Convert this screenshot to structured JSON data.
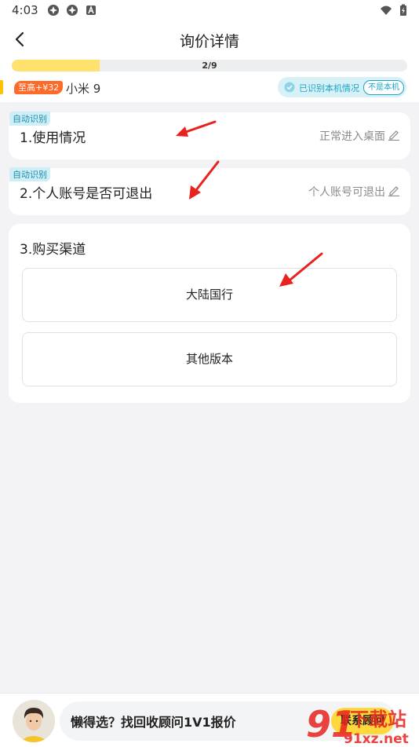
{
  "status_bar": {
    "time": "4:03"
  },
  "header": {
    "title": "询价详情"
  },
  "progress": {
    "text": "2/9",
    "fraction": 0.2222
  },
  "info": {
    "price_badge": "至高+¥32",
    "model": "小米 9",
    "detect_text": "已识别本机情况",
    "not_this_label": "不是本机"
  },
  "questions": [
    {
      "tag": "自动识别",
      "title": "1.使用情况",
      "value": "正常进入桌面"
    },
    {
      "tag": "自动识别",
      "title": "2.个人账号是否可退出",
      "value": "个人账号可退出"
    },
    {
      "title": "3.购买渠道",
      "options": [
        "大陆国行",
        "其他版本"
      ]
    }
  ],
  "bottom": {
    "consult_text": "懒得选？找回收顾问1V1报价",
    "contact_label": "联系顾问"
  },
  "watermark": {
    "text1": "下载站",
    "text2": "91xz.net"
  },
  "colors": {
    "accent_yellow": "#ffe16d",
    "badge_orange": "#ff6a28",
    "detect_blue": "#19a5c8",
    "annotation_red": "#e8231f"
  },
  "icons": [
    "back-icon",
    "status-app-icon",
    "wifi-icon",
    "battery-icon",
    "check-circle-icon",
    "edit-icon",
    "red-arrow"
  ]
}
